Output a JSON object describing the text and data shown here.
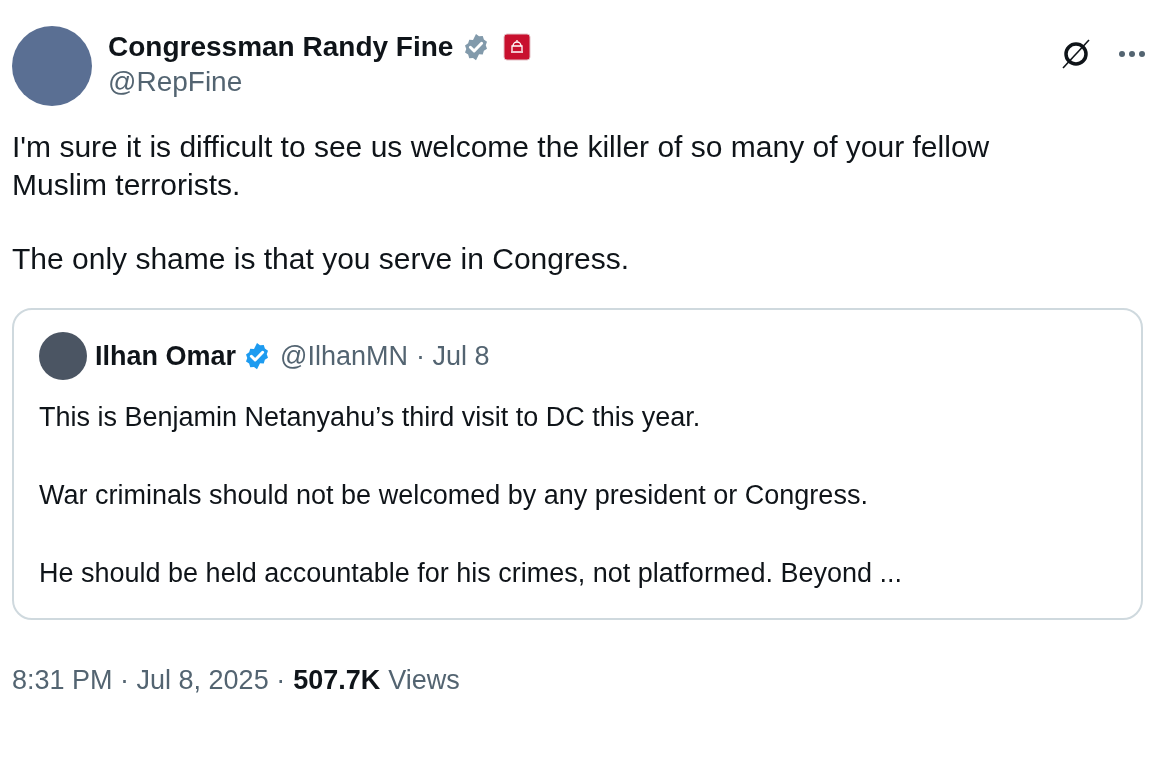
{
  "author": {
    "name": "Congressman Randy Fine",
    "handle": "@RepFine",
    "verified": true
  },
  "body": [
    "I'm sure it is difficult to see us welcome the killer of so many of your fellow Muslim terrorists.",
    "The only shame is that you serve in Congress."
  ],
  "quote": {
    "name": "Ilhan Omar",
    "verified": true,
    "handle": "@IlhanMN",
    "date": "· Jul 8",
    "paragraphs": [
      "This is Benjamin Netanyahu’s third visit to DC this year.",
      "War criminals should not be welcomed by any president or Congress.",
      "He should be held accountable for his crimes, not platformed. Beyond ..."
    ]
  },
  "footer": {
    "timestamp": "8:31 PM · Jul 8, 2025 ·",
    "views_count": "507.7K",
    "views_label": "Views"
  }
}
